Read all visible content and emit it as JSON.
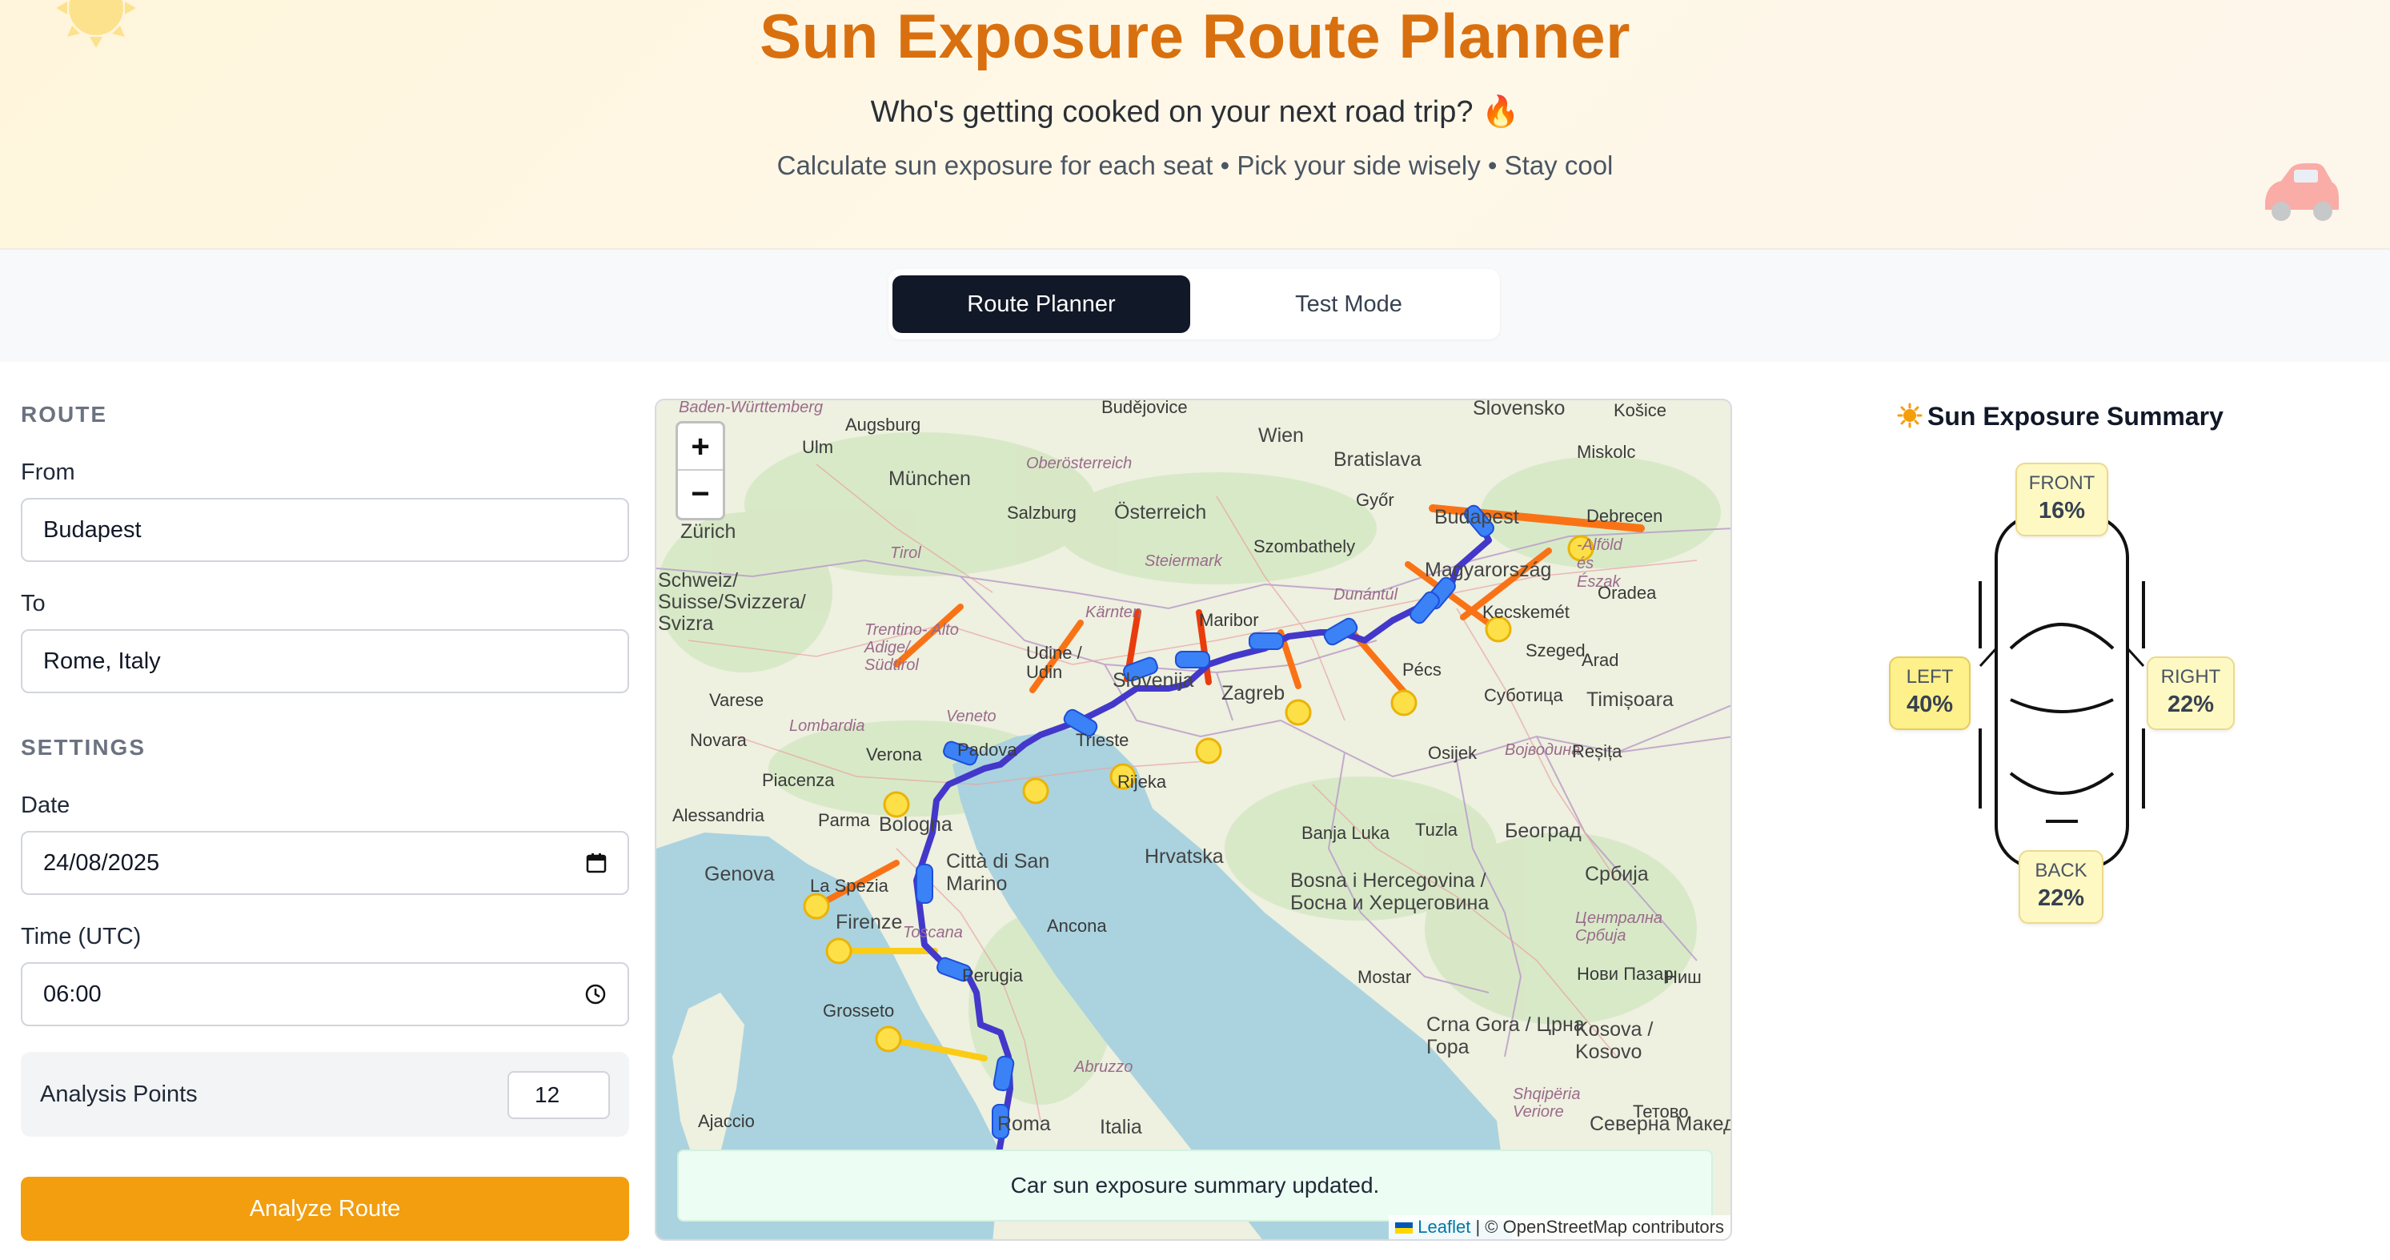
{
  "header": {
    "title": "Sun Exposure Route Planner",
    "subtitle": "Who's getting cooked on your next road trip? 🔥",
    "tagline": "Calculate sun exposure for each seat • Pick your side wisely • Stay cool"
  },
  "tabs": [
    {
      "label": "Route Planner",
      "active": true
    },
    {
      "label": "Test Mode",
      "active": false
    }
  ],
  "route": {
    "section_label": "ROUTE",
    "from_label": "From",
    "from_value": "Budapest",
    "to_label": "To",
    "to_value": "Rome, Italy"
  },
  "settings": {
    "section_label": "SETTINGS",
    "date_label": "Date",
    "date_value": "24/08/2025",
    "time_label": "Time (UTC)",
    "time_value": "06:00",
    "analysis_points_label": "Analysis Points",
    "analysis_points_value": "12"
  },
  "analyze_button": "Analyze Route",
  "map": {
    "zoom_in": "+",
    "zoom_out": "−",
    "toast": "Car sun exposure summary updated.",
    "attribution_link": "Leaflet",
    "attribution_text": "| © OpenStreetMap contributors",
    "labels": {
      "baden": "Baden-Württemberg",
      "augsburg": "Augsburg",
      "ulm": "Ulm",
      "budejovice": "Budějovice",
      "wien": "Wien",
      "bratislava": "Bratislava",
      "slovensko": "Slovensko",
      "kosice": "Košice",
      "miskolc": "Miskolc",
      "munchen": "München",
      "oberosterreich": "Oberösterreich",
      "salzburg": "Salzburg",
      "osterreich": "Österreich",
      "gyor": "Győr",
      "budapest": "Budapest",
      "debrecen": "Debrecen",
      "zurich": "Zürich",
      "tirol": "Tirol",
      "szombathely": "Szombathely",
      "steiermark": "Steiermark",
      "dunantul": "Dunántúl",
      "magyarorszag": "Magyarország",
      "eszak": "-Alföld és Észak",
      "oradea": "Oradea",
      "schweiz": "Schweiz/ Suisse/Svizzera/ Svizra",
      "karnten": "Kärnten",
      "kecskemet": "Kecskemét",
      "trentino": "Trentino- Alto Adige/ Südtirol",
      "udine": "Udine / Udin",
      "maribor": "Maribor",
      "slovenija": "Slovenija",
      "zagreb": "Zagreb",
      "pecs": "Pécs",
      "szeged": "Szeged",
      "arad": "Arad",
      "varese": "Varese",
      "veneto": "Veneto",
      "trieste": "Trieste",
      "subotica": "Суботица",
      "timisoara": "Timișoara",
      "novara": "Novara",
      "lombardia": "Lombardia",
      "padova": "Padova",
      "rijeka": "Rijeka",
      "osijek": "Osijek",
      "vojvodina": "Војводина",
      "resita": "Reșița",
      "verona": "Verona",
      "piacenza": "Piacenza",
      "alessandria": "Alessandria",
      "parma": "Parma",
      "bologna": "Bologna",
      "hrvatska": "Hrvatska",
      "banjaluka": "Banja Luka",
      "tuzla": "Tuzla",
      "beograd": "Београд",
      "genova": "Genova",
      "laspezia": "La Spezia",
      "sanmarino": "Città di San Marino",
      "bosna": "Bosna i Hercegovina / Босна и Херцеговина",
      "srbija": "Србија",
      "firenze": "Firenze",
      "toscana": "Toscana",
      "ancona": "Ancona",
      "centralna": "Централна Србија",
      "perugia": "Perugia",
      "mostar": "Mostar",
      "novipazar": "Нови Пазар",
      "nis": "Ниш",
      "grosseto": "Grosseto",
      "crnagora": "Crna Gora / Црна Гора",
      "kosova": "Kosova / Kosovo",
      "abruzzo": "Abruzzo",
      "shqiperia": "Shqipëria Veriore",
      "tetovo": "Тетово",
      "ajaccio": "Ajaccio",
      "italia": "Italia",
      "roma": "Roma",
      "severna": "Северна Македонија"
    }
  },
  "summary": {
    "title": "Sun Exposure Summary",
    "title_icon": "sun-icon",
    "front_label": "FRONT",
    "front_value": "16%",
    "left_label": "LEFT",
    "left_value": "40%",
    "right_label": "RIGHT",
    "right_value": "22%",
    "back_label": "BACK",
    "back_value": "22%"
  },
  "colors": {
    "accent": "#d9700f",
    "button": "#f29e0e",
    "route": "#4338ca",
    "sun_ray_orange": "#f97316",
    "sun_ray_yellow": "#facc15",
    "sun_ray_red": "#ea3b0c"
  }
}
